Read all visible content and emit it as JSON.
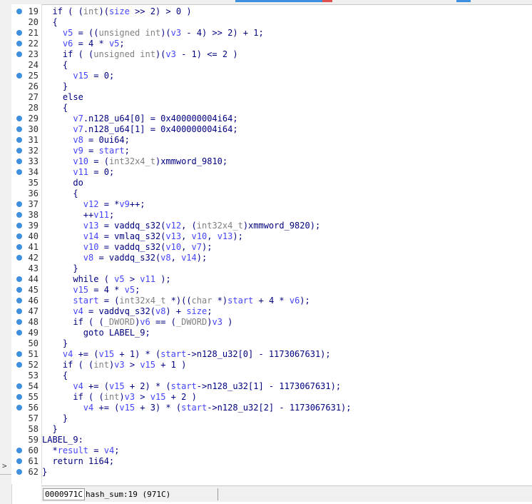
{
  "tab_accents": [
    {
      "color": "#3d8fe0"
    },
    {
      "color": "#e05050"
    },
    {
      "color": "#3d8fe0"
    }
  ],
  "gutter": [
    {
      "n": "19",
      "dot": true
    },
    {
      "n": "20",
      "dot": false
    },
    {
      "n": "21",
      "dot": true
    },
    {
      "n": "22",
      "dot": true
    },
    {
      "n": "23",
      "dot": true
    },
    {
      "n": "24",
      "dot": false
    },
    {
      "n": "25",
      "dot": true
    },
    {
      "n": "26",
      "dot": false
    },
    {
      "n": "27",
      "dot": false
    },
    {
      "n": "28",
      "dot": false
    },
    {
      "n": "29",
      "dot": true
    },
    {
      "n": "30",
      "dot": true
    },
    {
      "n": "31",
      "dot": true
    },
    {
      "n": "32",
      "dot": true
    },
    {
      "n": "33",
      "dot": true
    },
    {
      "n": "34",
      "dot": true
    },
    {
      "n": "35",
      "dot": false
    },
    {
      "n": "36",
      "dot": false
    },
    {
      "n": "37",
      "dot": true
    },
    {
      "n": "38",
      "dot": true
    },
    {
      "n": "39",
      "dot": true
    },
    {
      "n": "40",
      "dot": true
    },
    {
      "n": "41",
      "dot": true
    },
    {
      "n": "42",
      "dot": true
    },
    {
      "n": "43",
      "dot": false
    },
    {
      "n": "44",
      "dot": true
    },
    {
      "n": "45",
      "dot": true
    },
    {
      "n": "46",
      "dot": true
    },
    {
      "n": "47",
      "dot": true
    },
    {
      "n": "48",
      "dot": true
    },
    {
      "n": "49",
      "dot": true
    },
    {
      "n": "50",
      "dot": false
    },
    {
      "n": "51",
      "dot": true
    },
    {
      "n": "52",
      "dot": true
    },
    {
      "n": "53",
      "dot": false
    },
    {
      "n": "54",
      "dot": true
    },
    {
      "n": "55",
      "dot": true
    },
    {
      "n": "56",
      "dot": true
    },
    {
      "n": "57",
      "dot": false
    },
    {
      "n": "58",
      "dot": false
    },
    {
      "n": "59",
      "dot": false
    },
    {
      "n": "60",
      "dot": true
    },
    {
      "n": "61",
      "dot": true
    },
    {
      "n": "62",
      "dot": true
    }
  ],
  "code_lines": [
    "  if ( (int)(size >> 2) > 0 )",
    "  {",
    "    v5 = ((unsigned int)(v3 - 4) >> 2) + 1;",
    "    v6 = 4 * v5;",
    "    if ( (unsigned int)(v3 - 1) <= 2 )",
    "    {",
    "      v15 = 0;",
    "    }",
    "    else",
    "    {",
    "      v7.n128_u64[0] = 0x400000004i64;",
    "      v7.n128_u64[1] = 0x400000004i64;",
    "      v8 = 0ui64;",
    "      v9 = start;",
    "      v10 = (int32x4_t)xmmword_9810;",
    "      v11 = 0;",
    "      do",
    "      {",
    "        v12 = *v9++;",
    "        ++v11;",
    "        v13 = vaddq_s32(v12, (int32x4_t)xmmword_9820);",
    "        v14 = vmlaq_s32(v13, v10, v13);",
    "        v10 = vaddq_s32(v10, v7);",
    "        v8 = vaddq_s32(v8, v14);",
    "      }",
    "      while ( v5 > v11 );",
    "      v15 = 4 * v5;",
    "      start = (int32x4_t *)((char *)start + 4 * v6);",
    "      v4 = vaddvq_s32(v8) + size;",
    "      if ( (_DWORD)v6 == (_DWORD)v3 )",
    "        goto LABEL_9;",
    "    }",
    "    v4 += (v15 + 1) * (start->n128_u32[0] - 1173067631);",
    "    if ( (int)v3 > v15 + 1 )",
    "    {",
    "      v4 += (v15 + 2) * (start->n128_u32[1] - 1173067631);",
    "      if ( (int)v3 > v15 + 2 )",
    "        v4 += (v15 + 3) * (start->n128_u32[2] - 1173067631);",
    "    }",
    "  }",
    "LABEL_9:",
    "  *result = v4;",
    "  return 1i64;",
    "}"
  ],
  "status": {
    "address": "0000971C",
    "location": "hash_sum:19 (971C)"
  },
  "left_panel": {
    "expand_glyph": ">"
  }
}
